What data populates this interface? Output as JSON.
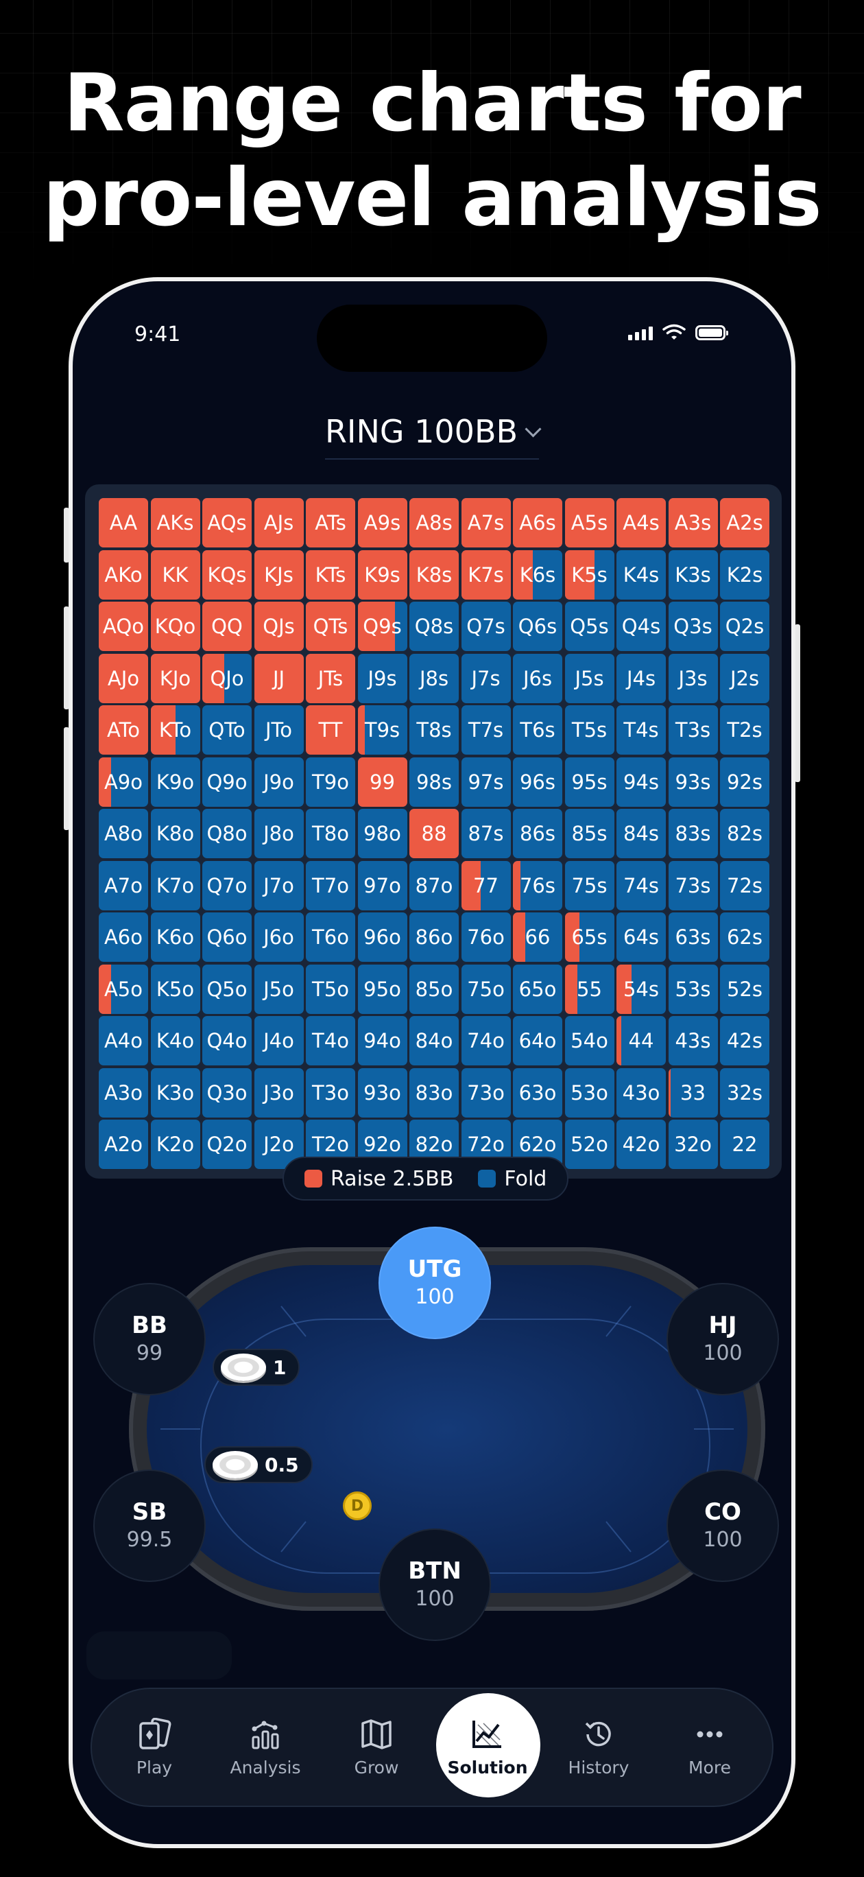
{
  "headline": {
    "line1": "Range charts for",
    "line2": "pro-level analysis"
  },
  "status_bar": {
    "time": "9:41",
    "icons": [
      "signal-icon",
      "wifi-icon",
      "battery-icon"
    ]
  },
  "title": {
    "label": "RING 100BB",
    "icon": "chevron-down-icon"
  },
  "colors": {
    "raise": "#ec5a43",
    "fold": "#0e62a3",
    "active_seat": "#4a9af7"
  },
  "range": {
    "cells": [
      [
        "AA",
        "AKs",
        "AQs",
        "AJs",
        "ATs",
        "A9s",
        "A8s",
        "A7s",
        "A6s",
        "A5s",
        "A4s",
        "A3s",
        "A2s"
      ],
      [
        "AKo",
        "KK",
        "KQs",
        "KJs",
        "KTs",
        "K9s",
        "K8s",
        "K7s",
        "K6s",
        "K5s",
        "K4s",
        "K3s",
        "K2s"
      ],
      [
        "AQo",
        "KQo",
        "QQ",
        "QJs",
        "QTs",
        "Q9s",
        "Q8s",
        "Q7s",
        "Q6s",
        "Q5s",
        "Q4s",
        "Q3s",
        "Q2s"
      ],
      [
        "AJo",
        "KJo",
        "QJo",
        "JJ",
        "JTs",
        "J9s",
        "J8s",
        "J7s",
        "J6s",
        "J5s",
        "J4s",
        "J3s",
        "J2s"
      ],
      [
        "ATo",
        "KTo",
        "QTo",
        "JTo",
        "TT",
        "T9s",
        "T8s",
        "T7s",
        "T6s",
        "T5s",
        "T4s",
        "T3s",
        "T2s"
      ],
      [
        "A9o",
        "K9o",
        "Q9o",
        "J9o",
        "T9o",
        "99",
        "98s",
        "97s",
        "96s",
        "95s",
        "94s",
        "93s",
        "92s"
      ],
      [
        "A8o",
        "K8o",
        "Q8o",
        "J8o",
        "T8o",
        "98o",
        "88",
        "87s",
        "86s",
        "85s",
        "84s",
        "83s",
        "82s"
      ],
      [
        "A7o",
        "K7o",
        "Q7o",
        "J7o",
        "T7o",
        "97o",
        "87o",
        "77",
        "76s",
        "75s",
        "74s",
        "73s",
        "72s"
      ],
      [
        "A6o",
        "K6o",
        "Q6o",
        "J6o",
        "T6o",
        "96o",
        "86o",
        "76o",
        "66",
        "65s",
        "64s",
        "63s",
        "62s"
      ],
      [
        "A5o",
        "K5o",
        "Q5o",
        "J5o",
        "T5o",
        "95o",
        "85o",
        "75o",
        "65o",
        "55",
        "54s",
        "53s",
        "52s"
      ],
      [
        "A4o",
        "K4o",
        "Q4o",
        "J4o",
        "T4o",
        "94o",
        "84o",
        "74o",
        "64o",
        "54o",
        "44",
        "43s",
        "42s"
      ],
      [
        "A3o",
        "K3o",
        "Q3o",
        "J3o",
        "T3o",
        "93o",
        "83o",
        "73o",
        "63o",
        "53o",
        "43o",
        "33",
        "32s"
      ],
      [
        "A2o",
        "K2o",
        "Q2o",
        "J2o",
        "T2o",
        "92o",
        "82o",
        "72o",
        "62o",
        "52o",
        "42o",
        "32o",
        "22"
      ]
    ],
    "raise_freq": {
      "AA": 1,
      "AKs": 1,
      "AQs": 1,
      "AJs": 1,
      "ATs": 1,
      "A9s": 1,
      "A8s": 1,
      "A7s": 1,
      "A6s": 1,
      "A5s": 1,
      "A4s": 1,
      "A3s": 1,
      "A2s": 1,
      "AKo": 1,
      "KK": 1,
      "KQs": 1,
      "KJs": 1,
      "KTs": 1,
      "K9s": 1,
      "K8s": 1,
      "K7s": 1,
      "K6s": 0.4,
      "K5s": 0.6,
      "AQo": 1,
      "KQo": 1,
      "QQ": 1,
      "QJs": 1,
      "QTs": 1,
      "Q9s": 0.75,
      "AJo": 1,
      "KJo": 1,
      "QJo": 0.45,
      "JJ": 1,
      "JTs": 1,
      "ATo": 1,
      "KTo": 0.5,
      "TT": 1,
      "T9s": 0.15,
      "A9o": 0.25,
      "99": 1,
      "88": 1,
      "77": 0.4,
      "76s": 0.15,
      "66": 0.25,
      "65s": 0.3,
      "A5o": 0.25,
      "55": 0.25,
      "54s": 0.3,
      "44": 0.1,
      "33": 0.05
    }
  },
  "legend": {
    "raise_label": "Raise 2.5BB",
    "fold_label": "Fold"
  },
  "table": {
    "seats": [
      {
        "id": "utg",
        "name": "UTG",
        "stack": "100",
        "active": true
      },
      {
        "id": "hj",
        "name": "HJ",
        "stack": "100"
      },
      {
        "id": "co",
        "name": "CO",
        "stack": "100"
      },
      {
        "id": "btn",
        "name": "BTN",
        "stack": "100"
      },
      {
        "id": "sb",
        "name": "SB",
        "stack": "99.5"
      },
      {
        "id": "bb",
        "name": "BB",
        "stack": "99"
      }
    ],
    "bets": {
      "bb": "1",
      "sb": "0.5"
    },
    "dealer_label": "D"
  },
  "tabs": [
    {
      "id": "play",
      "label": "Play",
      "icon": "cards-icon"
    },
    {
      "id": "analysis",
      "label": "Analysis",
      "icon": "analysis-icon"
    },
    {
      "id": "grow",
      "label": "Grow",
      "icon": "map-icon"
    },
    {
      "id": "solution",
      "label": "Solution",
      "icon": "solution-chart-icon",
      "active": true
    },
    {
      "id": "history",
      "label": "History",
      "icon": "history-icon"
    },
    {
      "id": "more",
      "label": "More",
      "icon": "more-icon"
    }
  ]
}
